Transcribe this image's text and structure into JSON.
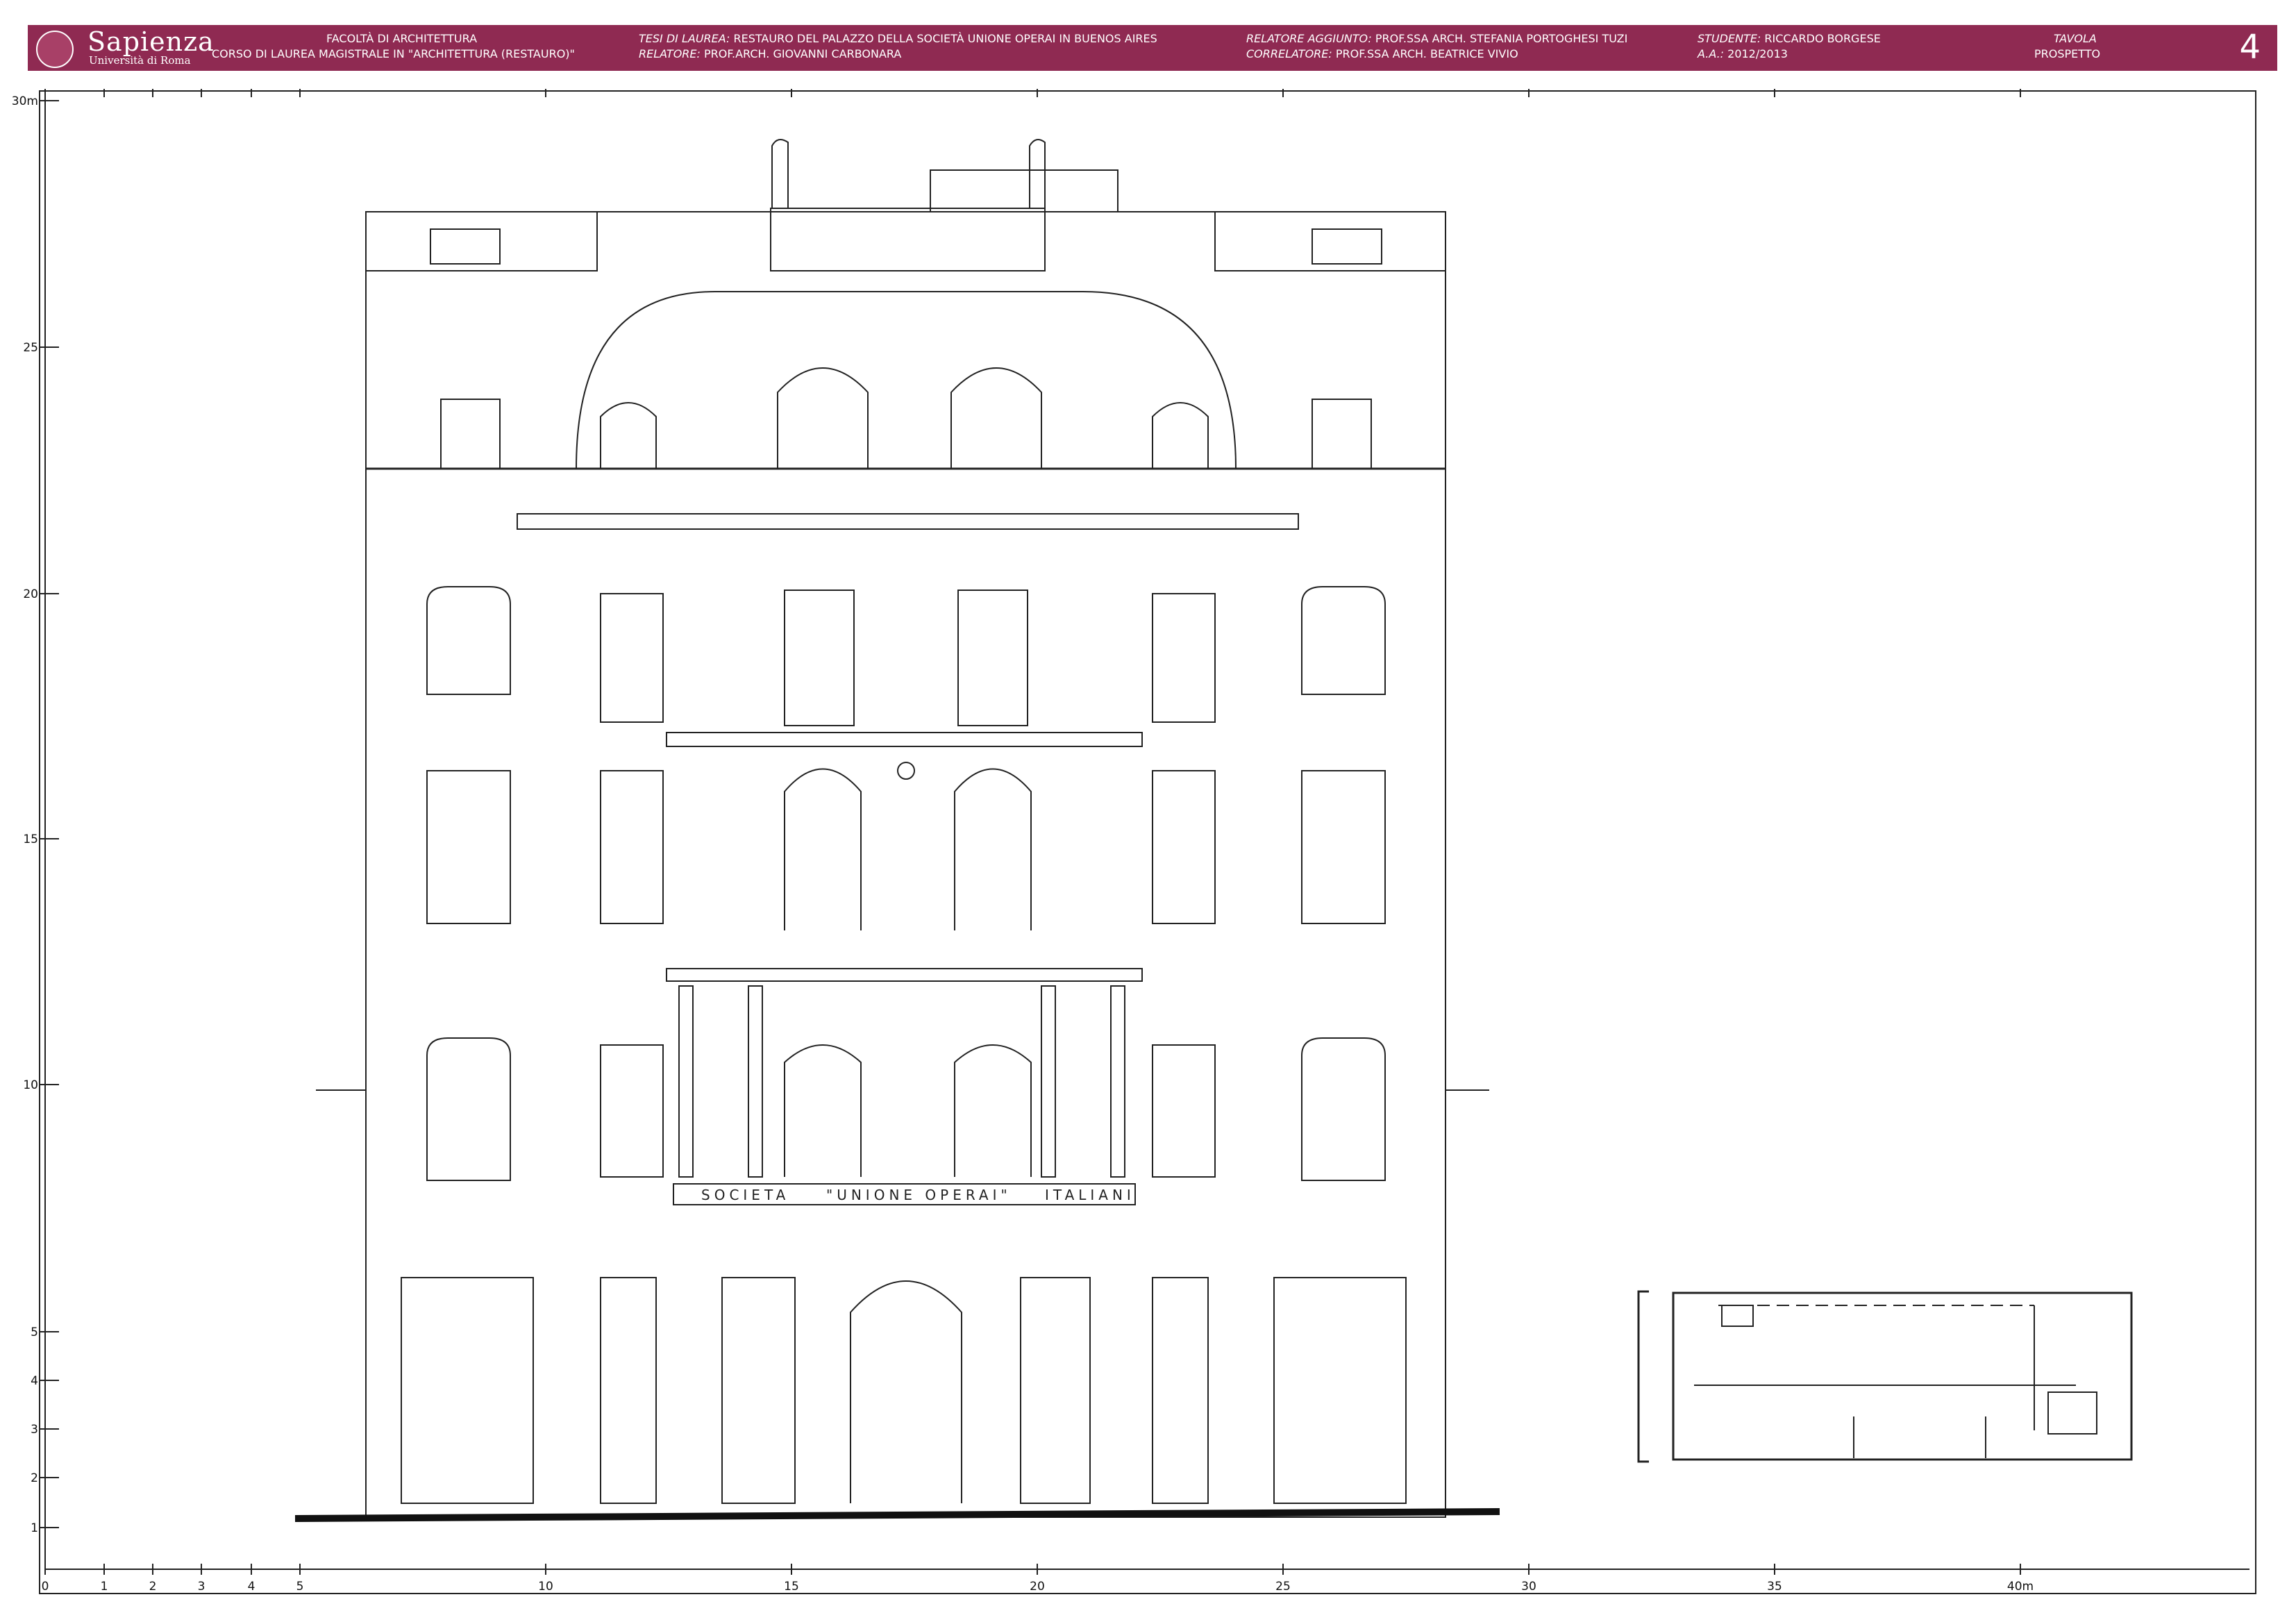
{
  "header": {
    "logo": {
      "name": "Sapienza",
      "sub": "Università di Roma"
    },
    "faculty": "FACOLTÀ DI ARCHITETTURA",
    "course": "CORSO DI LAUREA MAGISTRALE IN \"ARCHITETTURA (RESTAURO)\"",
    "thesis_label": "TESI DI LAUREA:",
    "thesis_value": "RESTAURO DEL PALAZZO DELLA SOCIETÀ UNIONE OPERAI IN BUENOS AIRES",
    "relatore_label": "RELATORE:",
    "relatore_value": "PROF.ARCH. GIOVANNI CARBONARA",
    "relatore_aggiunto_label": "RELATORE AGGIUNTO:",
    "relatore_aggiunto_value": "PROF.SSA ARCH. STEFANIA PORTOGHESI TUZI",
    "correlatore_label": "CORRELATORE:",
    "correlatore_value": "PROF.SSA ARCH. BEATRICE VIVIO",
    "studente_label": "STUDENTE:",
    "studente_value": "RICCARDO BORGESE",
    "aa_label": "A.A.:",
    "aa_value": "2012/2013",
    "tavola_label": "TAVOLA",
    "tavola_value": "PROSPETTO",
    "sheet_number": "4"
  },
  "drawing": {
    "facade_sign": [
      "SOCIETA",
      "\"UNIONE OPERAI\"",
      "ITALIANI"
    ],
    "x_scale_labels": [
      "0",
      "1",
      "2",
      "3",
      "4",
      "5",
      "10",
      "15",
      "20",
      "25",
      "30",
      "35",
      "40m"
    ],
    "y_scale_labels": [
      "30m",
      "25",
      "20",
      "15",
      "10",
      "5",
      "4",
      "3",
      "2",
      "1"
    ]
  },
  "colors": {
    "header_bg": "#8f2a52",
    "line": "#222222"
  }
}
